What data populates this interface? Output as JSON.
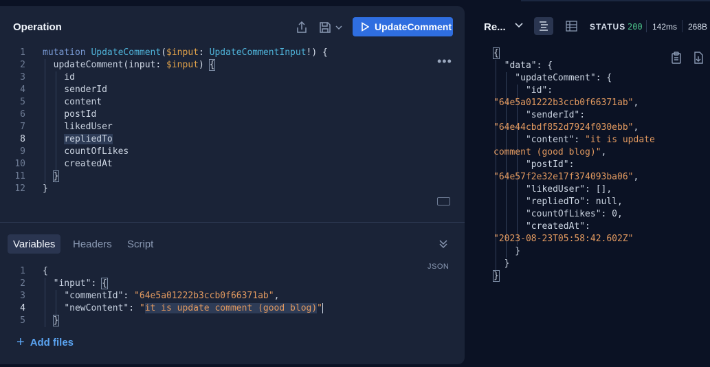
{
  "operation": {
    "title": "Operation",
    "run_label": "UpdateComment",
    "menu_glyph": "•••"
  },
  "editor_lines": [
    "mutation UpdateComment($input: UpdateCommentInput!) {",
    "  updateComment(input: $input) {",
    "    id",
    "    senderId",
    "    content",
    "    postId",
    "    likedUser",
    "    repliedTo",
    "    countOfLikes",
    "    createdAt",
    "  }",
    "}"
  ],
  "editor_active_line": 8,
  "tabs": [
    {
      "label": "Variables",
      "active": true
    },
    {
      "label": "Headers",
      "active": false
    },
    {
      "label": "Script",
      "active": false
    }
  ],
  "variables_mode": "JSON",
  "variables_lines": [
    "{",
    "  \"input\": {",
    "    \"commentId\": \"64e5a01222b3ccb0f66371ab\",",
    "    \"newContent\": \"it is update comment (good blog)\"",
    "  }"
  ],
  "variables_active_line": 4,
  "add_files_label": "Add files",
  "response": {
    "title": "Re...",
    "status_label": "STATUS",
    "status_code": "200",
    "time": "142ms",
    "size": "268B",
    "lines": [
      "{",
      "  \"data\": {",
      "    \"updateComment\": {",
      "      \"id\":",
      "\"64e5a01222b3ccb0f66371ab\",",
      "      \"senderId\":",
      "\"64e44cbdf852d7924f030ebb\",",
      "      \"content\": \"it is update",
      "comment (good blog)\",",
      "      \"postId\":",
      "\"64e57f2e32e17f374093ba06\",",
      "      \"likedUser\": [],",
      "      \"repliedTo\": null,",
      "      \"countOfLikes\": 0,",
      "      \"createdAt\":",
      "\"2023-08-23T05:58:42.602Z\"",
      "    }",
      "  }",
      "}"
    ]
  },
  "colors": {
    "accent": "#2f6ee0",
    "status_ok": "#4cc38a",
    "string": "#e39a60",
    "keyword": "#7a9bd6",
    "function": "#4fb3d9"
  }
}
